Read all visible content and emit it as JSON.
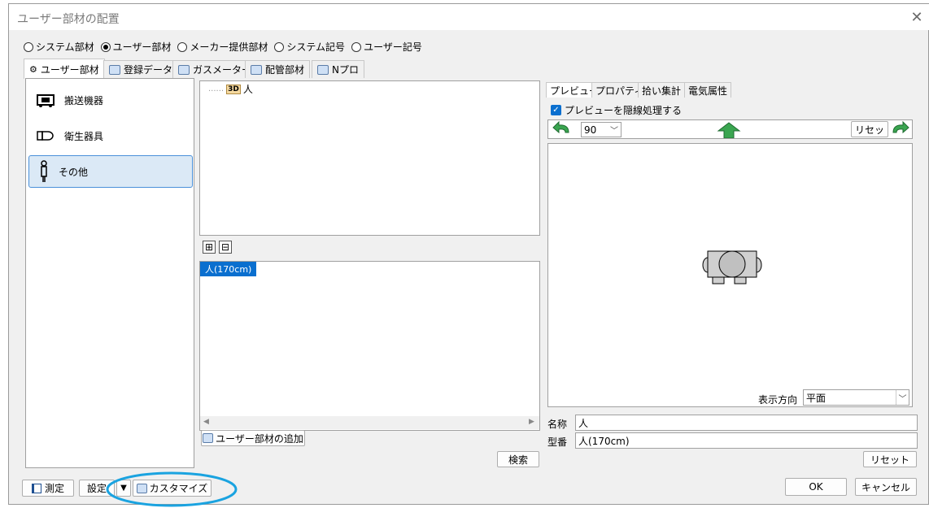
{
  "window": {
    "title": "ユーザー部材の配置",
    "close": "✕"
  },
  "radio_options": [
    {
      "label": "システム部材",
      "selected": false
    },
    {
      "label": "ユーザー部材",
      "selected": true
    },
    {
      "label": "メーカー提供部材",
      "selected": false
    },
    {
      "label": "システム記号",
      "selected": false
    },
    {
      "label": "ユーザー記号",
      "selected": false
    }
  ],
  "tabs": [
    "ユーザー部材",
    "登録データ",
    "ガスメーター",
    "配管部材",
    "Nプロ"
  ],
  "categories": [
    "搬送機器",
    "衛生器具",
    "その他"
  ],
  "tree": {
    "badge": "3D",
    "item": "人"
  },
  "expand_buttons": {
    "plus": "⊞",
    "minus": "⊟"
  },
  "list": {
    "selected_item": "人(170cm)"
  },
  "buttons": {
    "add_user_part": "ユーザー部材の追加",
    "search": "検索",
    "measure": "測定",
    "settings": "設定",
    "customize": "カスタマイズ",
    "ok": "OK",
    "cancel": "キャンセル",
    "reset_bottom": "リセット",
    "reset_toolbar": "リセッ"
  },
  "right_tabs": [
    "プレビュー",
    "プロパティ",
    "拾い集計",
    "電気属性"
  ],
  "hidden_line_checkbox": {
    "label": "プレビューを隠線処理する",
    "checked": true
  },
  "angle_select": {
    "value": "90"
  },
  "display_direction": {
    "label": "表示方向",
    "value": "平面"
  },
  "fields": {
    "name_label": "名称",
    "name_value": "人",
    "model_label": "型番",
    "model_value": "人(170cm)"
  },
  "colors": {
    "accent": "#0a6fcf",
    "highlight_circle": "#1aa3e0",
    "arrow_green": "#2f9e44"
  }
}
